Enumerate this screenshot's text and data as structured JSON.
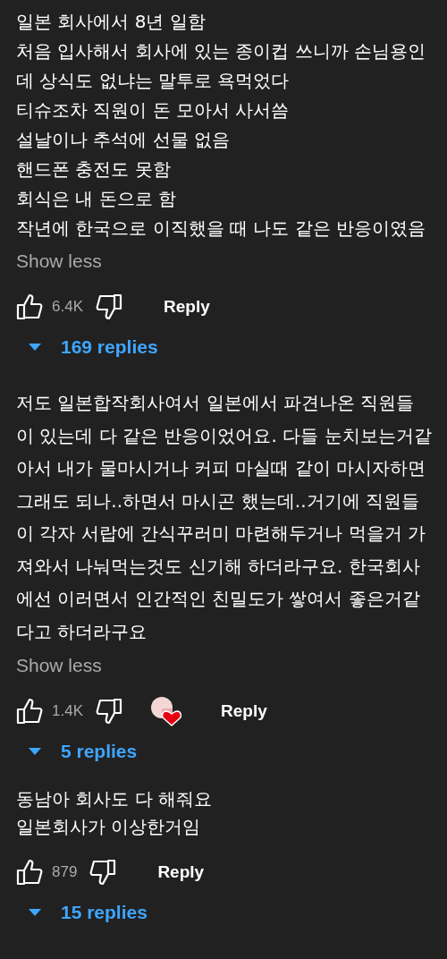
{
  "comments": [
    {
      "lines": [
        "일본 회사에서 8년 일함",
        "처음 입사해서 회사에 있는 종이컵 쓰니까 손님용인",
        "데 상식도 없냐는 말투로 욕먹었다",
        "티슈조차 직원이 돈 모아서 사서씀",
        "설날이나 추석에 선물 없음",
        "핸드폰 충전도 못함",
        "회식은 내 돈으로 함",
        "작년에 한국으로 이직했을 때 나도 같은 반응이였음"
      ],
      "toggle": "Show less",
      "likes": "6.4K",
      "hearted": false,
      "reply": "Reply",
      "replies": "169 replies"
    },
    {
      "lines": [
        "저도 일본합작회사여서 일본에서 파견나온 직원들",
        "이 있는데 다 같은 반응이었어요. 다들 눈치보는거같",
        "아서 내가 물마시거나 커피 마실때 같이 마시자하면",
        "그래도 되나..하면서 마시곤 했는데..거기에 직원들",
        "이 각자 서랍에 간식꾸러미 마련해두거나 먹을거 가",
        "져와서 나눠먹는것도 신기해 하더라구요. 한국회사",
        "에선 이러면서 인간적인 친밀도가 쌓여서 좋은거같",
        "다고 하더라구요"
      ],
      "toggle": "Show less",
      "likes": "1.4K",
      "hearted": true,
      "reply": "Reply",
      "replies": "5 replies"
    },
    {
      "lines": [
        "동남아 회사도 다 해줘요",
        "일본회사가 이상한거임"
      ],
      "likes": "879",
      "hearted": false,
      "reply": "Reply",
      "replies": "15 replies"
    }
  ]
}
